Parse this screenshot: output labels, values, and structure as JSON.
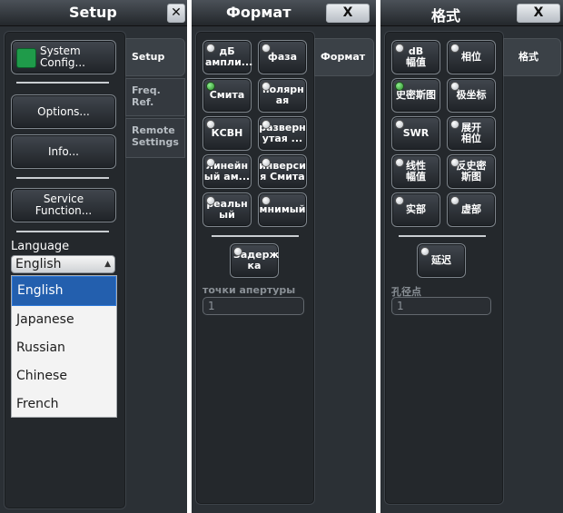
{
  "left": {
    "title": "Setup",
    "close_glyph": "✕",
    "buttons": {
      "system_config": "System Config...",
      "options": "Options...",
      "info": "Info...",
      "service": "Service Function..."
    },
    "language_label": "Language",
    "language_value": "English",
    "language_options": [
      "English",
      "Japanese",
      "Russian",
      "Chinese",
      "French"
    ],
    "tabs": [
      "Setup",
      "Freq. Ref.",
      "Remote Settings"
    ]
  },
  "middle": {
    "title": "Формат",
    "close_glyph": "X",
    "buttons": [
      "дБ ампли...",
      "фаза",
      "Смита",
      "полярн ая",
      "КСВН",
      "разверн утая ...",
      "линейн ый ам...",
      "инверси я Смита",
      "реальн ый",
      "мнимый"
    ],
    "delay": "Задерж ка",
    "aperture_label": "точки апертуры",
    "aperture_value": "1",
    "tab": "Формат"
  },
  "right": {
    "title": "格式",
    "close_glyph": "X",
    "buttons": [
      "dB 幅值",
      "相位",
      "史密斯图",
      "极坐标",
      "SWR",
      "展开 相位",
      "线性 幅值",
      "反史密 斯图",
      "实部",
      "虚部"
    ],
    "delay": "延迟",
    "aperture_label": "孔径点",
    "aperture_value": "1",
    "tab": "格式"
  }
}
